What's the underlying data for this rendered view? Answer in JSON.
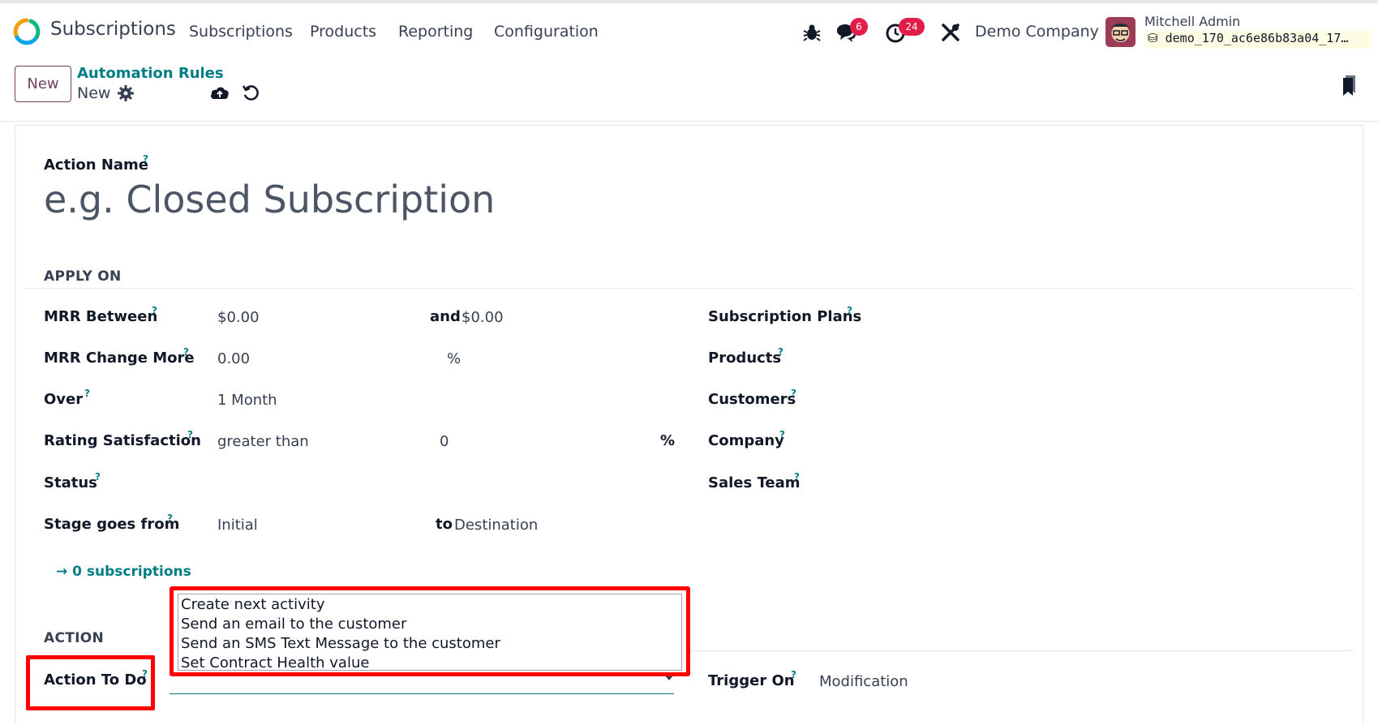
{
  "navbar": {
    "app_title": "Subscriptions",
    "menu": [
      "Subscriptions",
      "Products",
      "Reporting",
      "Configuration"
    ],
    "messages_count": "6",
    "activities_count": "24",
    "company": "Demo Company",
    "user_name": "Mitchell Admin",
    "database": "demo_170_ac6e86b83a04_17…"
  },
  "control_panel": {
    "new_label": "New",
    "breadcrumb_parent": "Automation Rules",
    "breadcrumb_current": "New"
  },
  "form": {
    "action_name_label": "Action Name",
    "action_name_placeholder": "e.g. Closed Subscription",
    "apply_on_title": "APPLY ON",
    "mrr_between_label": "MRR Between",
    "mrr_min": "$0.00",
    "and_label": "and",
    "mrr_max": "$0.00",
    "mrr_change_label": "MRR Change More",
    "mrr_change_value": "0.00",
    "percent_unit": "%",
    "over_label": "Over",
    "over_value": "1 Month",
    "rating_label": "Rating Satisfaction",
    "rating_operator": "greater than",
    "rating_value": "0",
    "status_label": "Status",
    "stage_from_label": "Stage goes from",
    "stage_from_value": "Initial",
    "to_label": "to",
    "stage_to_value": "Destination",
    "subscription_plans_label": "Subscription Plans",
    "products_label": "Products",
    "customers_label": "Customers",
    "company_label": "Company",
    "sales_team_label": "Sales Team",
    "smart_link": "→ 0 subscriptions",
    "action_title": "ACTION",
    "action_to_do_label": "Action To Do",
    "action_options": [
      "Create next activity",
      "Send an email to the customer",
      "Send an SMS Text Message to the customer",
      "Set Contract Health value"
    ],
    "trigger_on_label": "Trigger On",
    "trigger_on_value": "Modification",
    "tooltip_mark": "?"
  },
  "colors": {
    "brand": "#71405e",
    "link": "#017e84",
    "badge": "#e11d48",
    "annotation": "#ff0000"
  }
}
